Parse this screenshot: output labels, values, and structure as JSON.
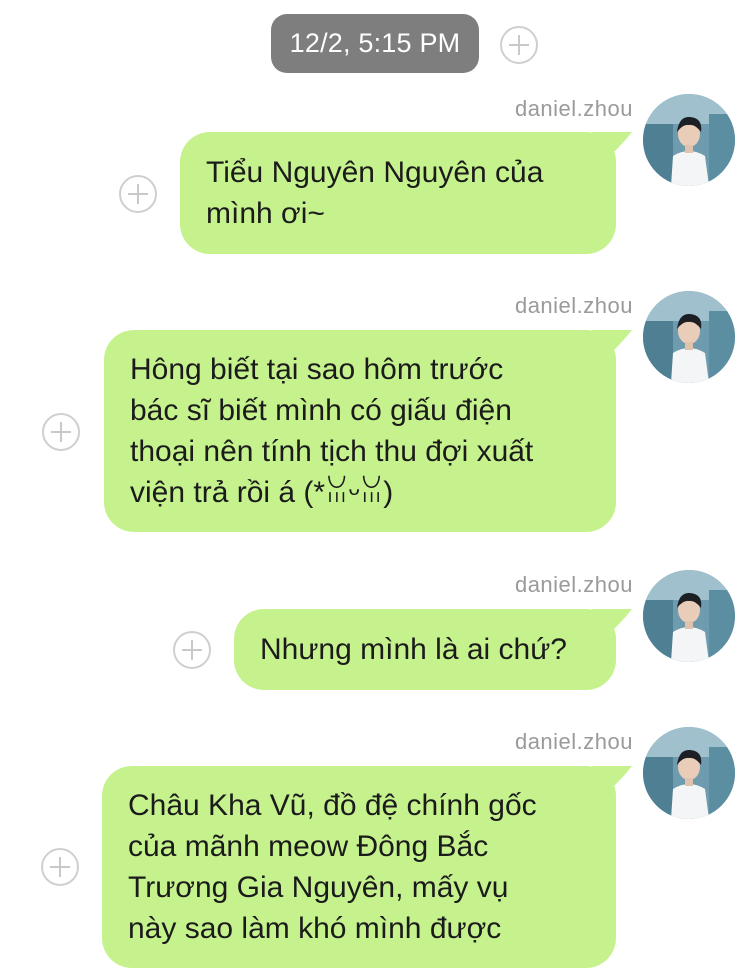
{
  "timestamp": "12/2, 5:15 PM",
  "colors": {
    "bubble": "#c6f28e",
    "timestamp_bg": "#7e7e7e",
    "sender_name": "#9a9a9a",
    "text": "#1b1b1b"
  },
  "icons": {
    "add": "plus-circle-icon",
    "avatar": "user-avatar-photo"
  },
  "messages": [
    {
      "sender": "daniel.zhou",
      "text": "Tiểu Nguyên Nguyên của\nmình ơi~"
    },
    {
      "sender": "daniel.zhou",
      "text": "Hông biết tại sao hôm trước\nbác sĩ biết mình có giấu điện\nthoại nên tính tịch thu đợi xuất\nviện trả rồi á (*ꈍᵕꈍ)"
    },
    {
      "sender": "daniel.zhou",
      "text": "Nhưng mình là ai chứ?"
    },
    {
      "sender": "daniel.zhou",
      "text": "Châu Kha Vũ, đồ đệ chính gốc\ncủa mãnh meow Đông Bắc\nTrương Gia Nguyên, mấy vụ\nnày sao làm khó mình được"
    }
  ]
}
